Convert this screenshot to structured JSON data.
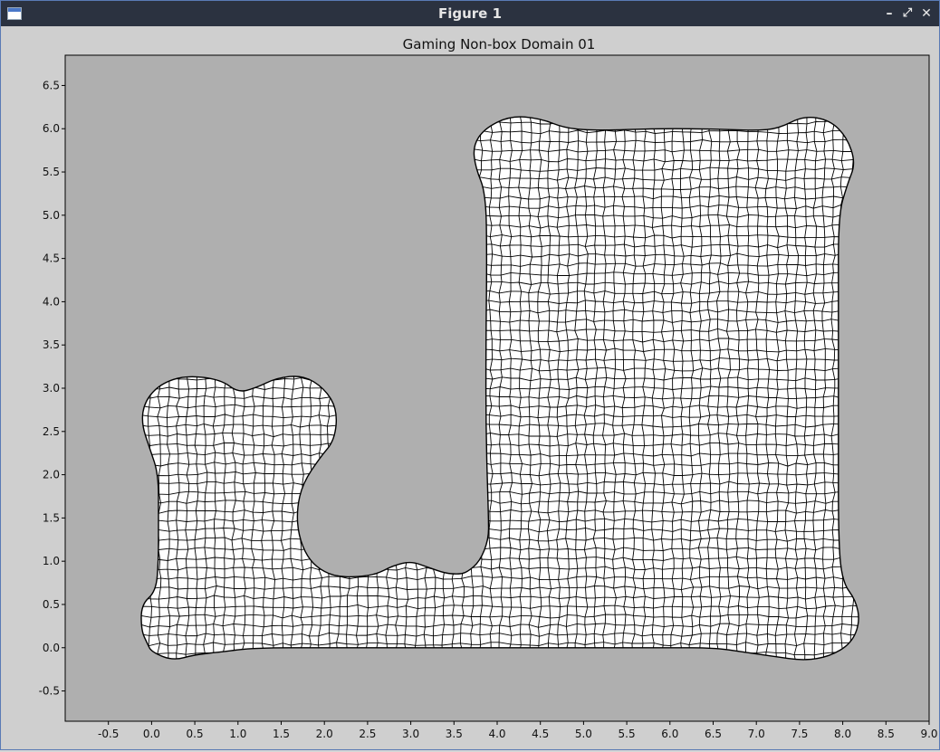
{
  "window": {
    "title": "Figure 1",
    "controls": {
      "minimize": "–",
      "restore": "⤢",
      "close": "✕"
    }
  },
  "chart_data": {
    "type": "mesh",
    "title": "Gaming Non-box Domain 01",
    "xlabel": "",
    "ylabel": "",
    "xlim": [
      -1.0,
      9.0
    ],
    "ylim": [
      -0.85,
      6.85
    ],
    "xticks": [
      "-0.5",
      "0.0",
      "0.5",
      "1.0",
      "1.5",
      "2.0",
      "2.5",
      "3.0",
      "3.5",
      "4.0",
      "4.5",
      "5.0",
      "5.5",
      "6.0",
      "6.5",
      "7.0",
      "7.5",
      "8.0",
      "8.5",
      "9.0"
    ],
    "xtick_values": [
      -0.5,
      0.0,
      0.5,
      1.0,
      1.5,
      2.0,
      2.5,
      3.0,
      3.5,
      4.0,
      4.5,
      5.0,
      5.5,
      6.0,
      6.5,
      7.0,
      7.5,
      8.0,
      8.5,
      9.0
    ],
    "yticks": [
      "-0.5",
      "0.0",
      "0.5",
      "1.0",
      "1.5",
      "2.0",
      "2.5",
      "3.0",
      "3.5",
      "4.0",
      "4.5",
      "5.0",
      "5.5",
      "6.0",
      "6.5"
    ],
    "ytick_values": [
      -0.5,
      0.0,
      0.5,
      1.0,
      1.5,
      2.0,
      2.5,
      3.0,
      3.5,
      4.0,
      4.5,
      5.0,
      5.5,
      6.0,
      6.5
    ],
    "colors": {
      "plot_background": "#afafaf",
      "mesh_fill": "#ffffff",
      "mesh_edge": "#000000"
    },
    "domain_outline": [
      [
        0.0,
        -0.05
      ],
      [
        0.25,
        -0.15
      ],
      [
        0.5,
        -0.08
      ],
      [
        0.8,
        -0.05
      ],
      [
        1.2,
        0.0
      ],
      [
        2.0,
        0.0
      ],
      [
        4.0,
        0.0
      ],
      [
        6.0,
        0.0
      ],
      [
        6.5,
        0.0
      ],
      [
        6.85,
        -0.05
      ],
      [
        7.2,
        -0.1
      ],
      [
        7.55,
        -0.15
      ],
      [
        7.85,
        -0.1
      ],
      [
        8.1,
        0.05
      ],
      [
        8.2,
        0.3
      ],
      [
        8.15,
        0.55
      ],
      [
        8.0,
        0.75
      ],
      [
        7.95,
        1.2
      ],
      [
        7.95,
        2.5
      ],
      [
        7.95,
        4.0
      ],
      [
        7.95,
        5.0
      ],
      [
        8.05,
        5.35
      ],
      [
        8.15,
        5.6
      ],
      [
        8.05,
        5.9
      ],
      [
        7.85,
        6.1
      ],
      [
        7.55,
        6.15
      ],
      [
        7.25,
        6.0
      ],
      [
        7.0,
        5.98
      ],
      [
        6.7,
        5.99
      ],
      [
        6.3,
        6.0
      ],
      [
        5.8,
        6.0
      ],
      [
        5.2,
        5.98
      ],
      [
        4.8,
        6.0
      ],
      [
        4.5,
        6.12
      ],
      [
        4.15,
        6.15
      ],
      [
        3.85,
        6.0
      ],
      [
        3.72,
        5.8
      ],
      [
        3.75,
        5.55
      ],
      [
        3.87,
        5.25
      ],
      [
        3.88,
        4.5
      ],
      [
        3.87,
        3.5
      ],
      [
        3.87,
        2.5
      ],
      [
        3.9,
        1.5
      ],
      [
        3.9,
        1.25
      ],
      [
        3.8,
        1.0
      ],
      [
        3.65,
        0.87
      ],
      [
        3.55,
        0.85
      ],
      [
        3.4,
        0.86
      ],
      [
        3.2,
        0.93
      ],
      [
        3.0,
        1.0
      ],
      [
        2.8,
        0.95
      ],
      [
        2.6,
        0.85
      ],
      [
        2.4,
        0.82
      ],
      [
        2.15,
        0.82
      ],
      [
        1.95,
        0.9
      ],
      [
        1.8,
        1.05
      ],
      [
        1.7,
        1.3
      ],
      [
        1.68,
        1.6
      ],
      [
        1.75,
        1.9
      ],
      [
        1.95,
        2.2
      ],
      [
        2.12,
        2.4
      ],
      [
        2.15,
        2.75
      ],
      [
        2.0,
        3.0
      ],
      [
        1.75,
        3.15
      ],
      [
        1.45,
        3.12
      ],
      [
        1.2,
        3.0
      ],
      [
        1.0,
        2.95
      ],
      [
        0.8,
        3.1
      ],
      [
        0.4,
        3.15
      ],
      [
        0.1,
        3.05
      ],
      [
        -0.08,
        2.85
      ],
      [
        -0.12,
        2.6
      ],
      [
        -0.02,
        2.3
      ],
      [
        0.08,
        2.0
      ],
      [
        0.08,
        1.5
      ],
      [
        0.08,
        1.0
      ],
      [
        0.05,
        0.65
      ],
      [
        -0.12,
        0.5
      ],
      [
        -0.12,
        0.2
      ],
      [
        -0.05,
        0.05
      ]
    ]
  }
}
